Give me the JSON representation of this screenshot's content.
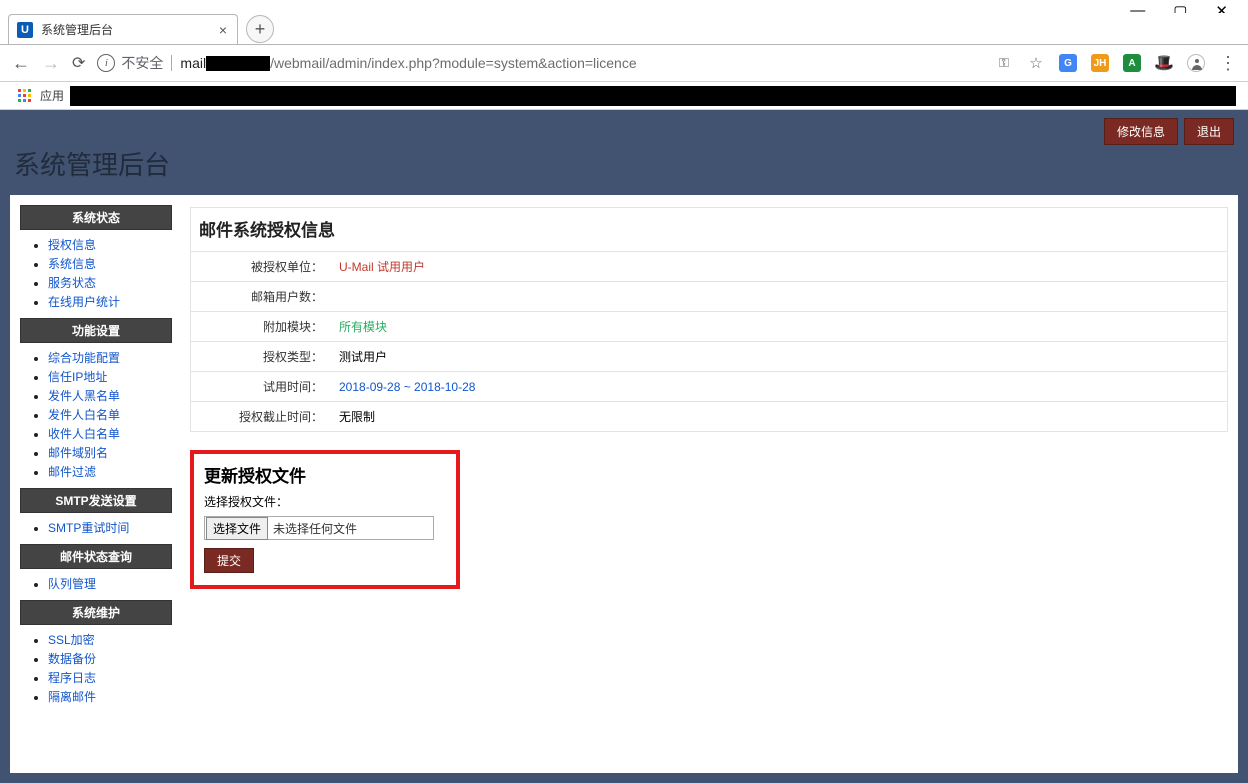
{
  "browser": {
    "tab_title": "系统管理后台",
    "tab_favicon_letter": "U",
    "url_insecure_label": "不安全",
    "url_host": "mail",
    "url_path": "/webmail/admin/index.php?module=system&action=licence",
    "bookmarks_apps": "应用"
  },
  "header": {
    "site_title": "系统管理后台",
    "edit_btn": "修改信息",
    "logout_btn": "退出"
  },
  "sidebar": {
    "g1_title": "系统状态",
    "g1_items": [
      "授权信息",
      "系统信息",
      "服务状态",
      "在线用户统计"
    ],
    "g2_title": "功能设置",
    "g2_items": [
      "综合功能配置",
      "信任IP地址",
      "发件人黑名单",
      "发件人白名单",
      "收件人白名单",
      "邮件域别名",
      "邮件过滤"
    ],
    "g3_title": "SMTP发送设置",
    "g3_items": [
      "SMTP重试时间"
    ],
    "g4_title": "邮件状态查询",
    "g4_items": [
      "队列管理"
    ],
    "g5_title": "系统维护",
    "g5_items": [
      "SSL加密",
      "数据备份",
      "程序日志",
      "隔离邮件"
    ]
  },
  "license_panel": {
    "title": "邮件系统授权信息",
    "rows": [
      {
        "label": "被授权单位：",
        "value": "U-Mail 试用用户",
        "cls": "val-red"
      },
      {
        "label": "邮箱用户数：",
        "value": "",
        "cls": ""
      },
      {
        "label": "附加模块：",
        "value": "所有模块",
        "cls": "val-green"
      },
      {
        "label": "授权类型：",
        "value": "测试用户",
        "cls": ""
      },
      {
        "label": "试用时间：",
        "value": "2018-09-28 ~ 2018-10-28",
        "cls": "val-blue"
      },
      {
        "label": "授权截止时间：",
        "value": "无限制",
        "cls": ""
      }
    ]
  },
  "update_panel": {
    "title": "更新授权文件",
    "label": "选择授权文件：",
    "choose_btn": "选择文件",
    "no_file": "未选择任何文件",
    "submit": "提交"
  }
}
